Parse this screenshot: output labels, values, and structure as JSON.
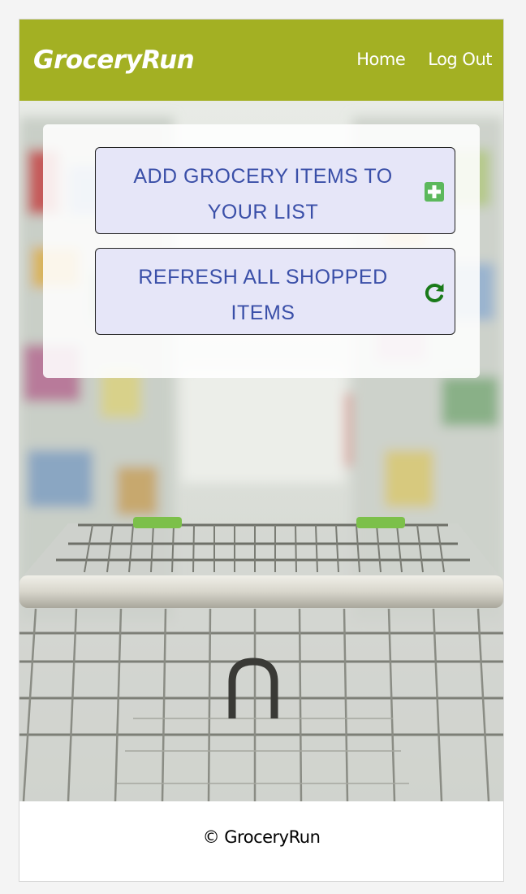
{
  "header": {
    "brand": "GroceryRun",
    "nav": [
      {
        "label": "Home"
      },
      {
        "label": "Log Out"
      }
    ]
  },
  "actions": [
    {
      "label": "ADD GROCERY ITEMS TO YOUR LIST",
      "icon": "plus-square-icon",
      "icon_color": "#5cb85c"
    },
    {
      "label": "REFRESH ALL SHOPPED ITEMS",
      "icon": "refresh-icon",
      "icon_color": "#1a7a1a"
    }
  ],
  "background": {
    "image": "shopping-cart-in-supermarket-aisle"
  },
  "footer": {
    "copyright": "© GroceryRun"
  },
  "colors": {
    "header": "#a3b023",
    "button_bg": "#e6e6f8",
    "button_text": "#3a4fa8"
  }
}
